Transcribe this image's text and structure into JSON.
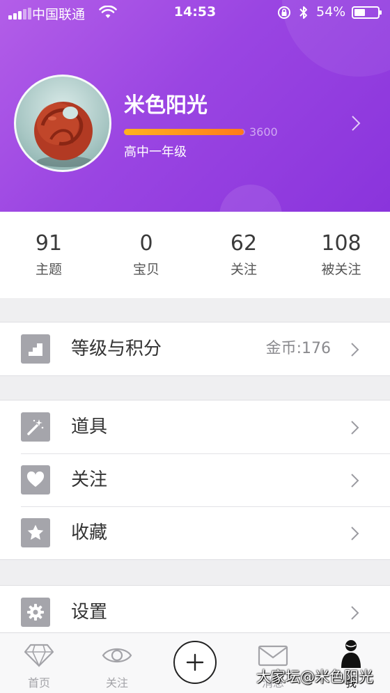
{
  "status_bar": {
    "carrier": "中国联通",
    "time": "14:53",
    "battery_percent": "54%",
    "battery_level": 0.54
  },
  "profile": {
    "username": "米色阳光",
    "level_progress": 0.99,
    "experience": "3600",
    "grade": "高中一年级"
  },
  "stats": [
    {
      "value": "91",
      "label": "主题"
    },
    {
      "value": "0",
      "label": "宝贝"
    },
    {
      "value": "62",
      "label": "关注"
    },
    {
      "value": "108",
      "label": "被关注"
    }
  ],
  "menu": {
    "level_points": {
      "label": "等级与积分",
      "value": "金币:176",
      "icon": "stairs-icon"
    },
    "items": [
      {
        "label": "道具",
        "icon": "magic-wand-icon"
      },
      {
        "label": "关注",
        "icon": "heart-icon"
      },
      {
        "label": "收藏",
        "icon": "star-icon"
      }
    ],
    "settings": {
      "label": "设置",
      "icon": "gear-icon"
    }
  },
  "tab_bar": {
    "items": [
      {
        "label": "首页",
        "icon": "diamond-icon"
      },
      {
        "label": "关注",
        "icon": "eye-icon"
      },
      {
        "label": "",
        "icon": "plus-icon"
      },
      {
        "label": "消息",
        "icon": "mail-icon"
      },
      {
        "label": "我",
        "icon": "person-icon"
      }
    ],
    "active": "我"
  },
  "watermark": "大家坛@米色阳光",
  "colors": {
    "header_gradient_start": "#b35ee8",
    "header_gradient_end": "#8a34dc",
    "progress_start": "#ffb21f",
    "progress_end": "#ff7a1a",
    "icon_gray": "#a5a5ab"
  }
}
